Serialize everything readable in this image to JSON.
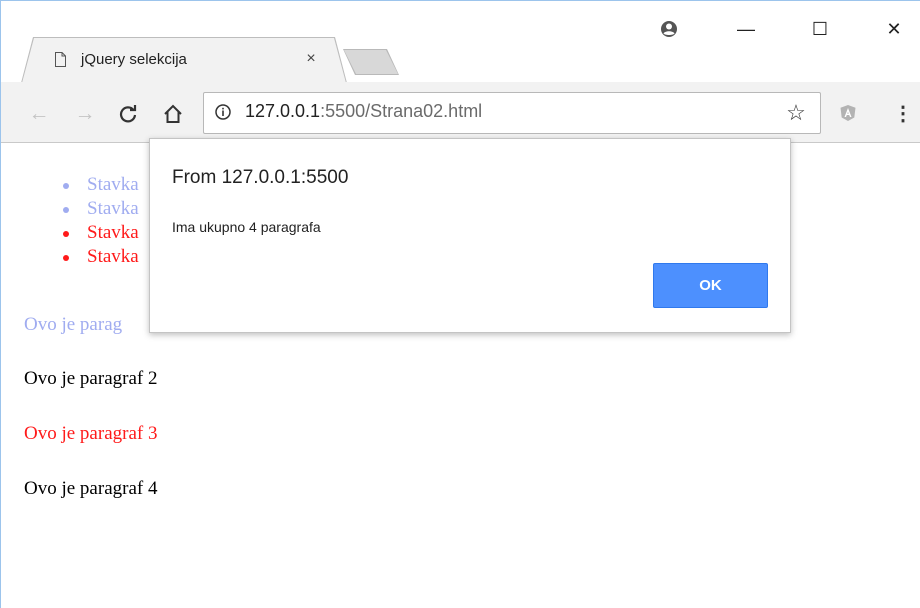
{
  "browser": {
    "tab": {
      "title": "jQuery selekcija",
      "close_glyph": "×",
      "icon": "document-icon"
    },
    "window_controls": {
      "profile_icon": "account-circle-icon",
      "minimize": "—",
      "maximize": "☐",
      "close": "✕"
    },
    "nav": {
      "back": "←",
      "forward": "→",
      "reload": "C",
      "home": "⌂"
    },
    "omnibox": {
      "host": "127.0.0.1",
      "rest": ":5500/Strana02.html",
      "info_icon": "info-icon"
    },
    "bookmark_star": "☆",
    "extension_icon": "angular-extension-icon",
    "menu": "⋮"
  },
  "page": {
    "list_items": [
      {
        "label": "Stavka",
        "color": "#a0acf0"
      },
      {
        "label": "Stavka",
        "color": "#a0acf0"
      },
      {
        "label": "Stavka",
        "color": "#ff1a1a"
      },
      {
        "label": "Stavka",
        "color": "#ff1a1a"
      }
    ],
    "paragraphs": [
      {
        "text": "Ovo je parag",
        "color": "#a0acf0"
      },
      {
        "text": "Ovo je paragraf 2",
        "color": "#000000"
      },
      {
        "text": "Ovo je paragraf 3",
        "color": "#ff1a1a"
      },
      {
        "text": "Ovo je paragraf 4",
        "color": "#000000"
      }
    ]
  },
  "dialog": {
    "title": "From 127.0.0.1:5500",
    "message": "Ima ukupno 4 paragrafa",
    "ok_label": "OK",
    "accent": "#4d90fe"
  }
}
